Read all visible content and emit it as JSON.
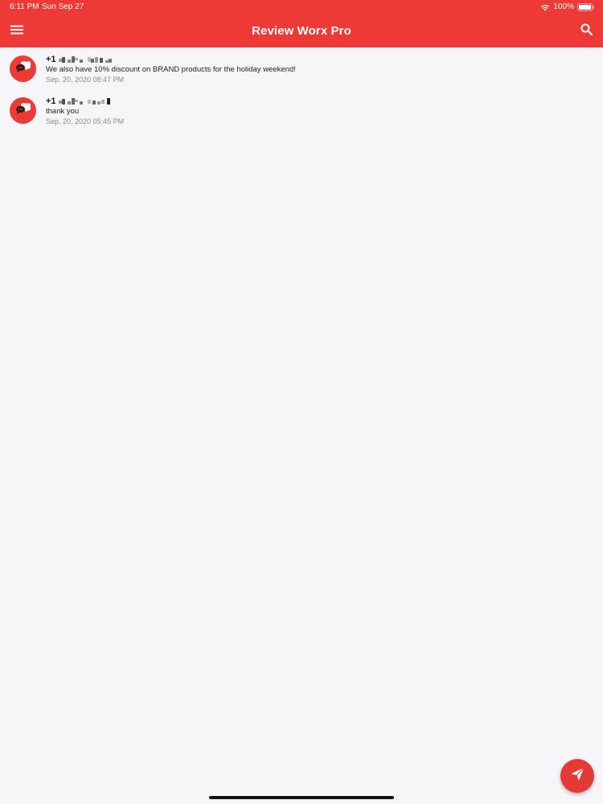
{
  "status_bar": {
    "time": "6:11 PM",
    "date": "Sun Sep 27",
    "battery": "100%",
    "icons": [
      "wifi-icon",
      "battery-icon"
    ]
  },
  "header": {
    "title": "Review Worx Pro",
    "icons": [
      "menu-icon",
      "search-icon"
    ]
  },
  "conversations": [
    {
      "phone": "+1",
      "message": "We also have 10% discount on BRAND products for the holiday weekend!",
      "timestamp": "Sep. 20, 2020 08:47 PM",
      "avatar_icon": "chat-bubbles-icon"
    },
    {
      "phone": "+1",
      "message": "thank you",
      "timestamp": "Sep. 20, 2020 05:45 PM",
      "avatar_icon": "chat-bubbles-icon"
    }
  ],
  "fab": {
    "icon": "send-icon"
  },
  "colors": {
    "brand": "#ee3a37",
    "background": "#f6f6f8",
    "timestamp": "#8a8a8e"
  }
}
